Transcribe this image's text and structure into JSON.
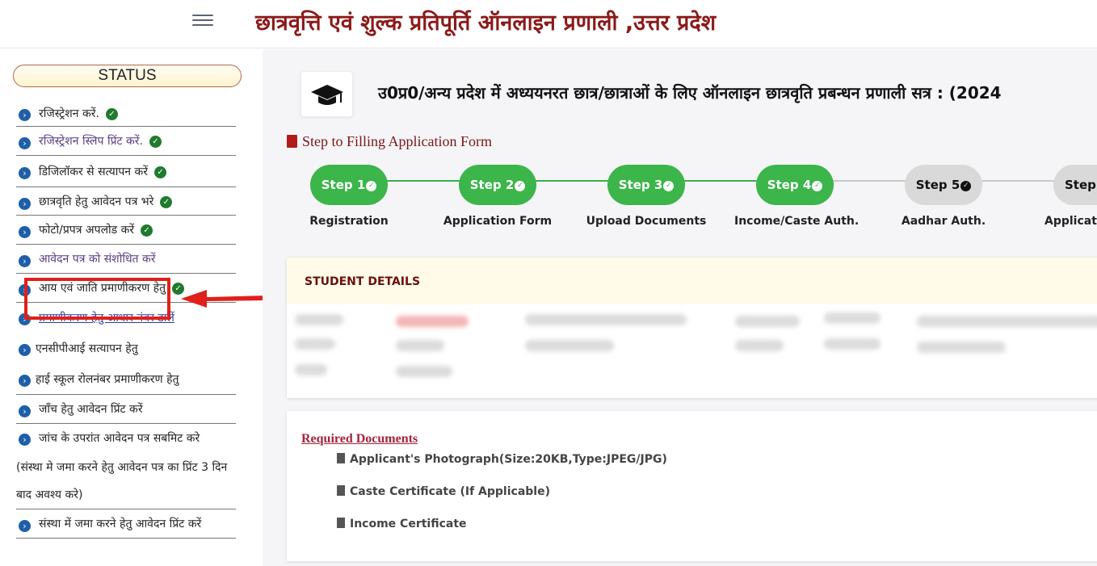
{
  "header": {
    "title": "छात्रवृत्ति एवं शुल्क प्रतिपूर्ति ऑनलाइन प्रणाली ,उत्तर प्रदेश"
  },
  "sidebar": {
    "status_label": "STATUS",
    "items": [
      {
        "label": "रजिस्ट्रेशन करें.",
        "done": true
      },
      {
        "label": "रजिस्ट्रेशन स्लिप प्रिंट करें.",
        "done": true
      },
      {
        "label": "डिजिलॉकर से सत्यापन करें",
        "done": true
      },
      {
        "label": "छात्रवृति हेतु आवेदन पत्र भरे",
        "done": true
      },
      {
        "label": "फोटो/प्रपत्र अपलोड करें",
        "done": true
      },
      {
        "label": "आवेदन पत्र को संशोधित करें",
        "done": false
      },
      {
        "label": "आय एवं जाति प्रमाणीकरण हेतु",
        "done": true
      },
      {
        "label": "प्रमाणीकरण हेतु आधार नंबर डालें",
        "done": false
      },
      {
        "label": "एनसीपीआई सत्यापन हेतु",
        "done": false
      },
      {
        "label": "हाई स्कूल रोलनंबर प्रमाणीकरण हेतु",
        "done": false
      },
      {
        "label": "जाँच हेतु आवेदन प्रिंट करें",
        "done": false
      },
      {
        "label": "जांच के उपरांत आवेदन पत्र सबमिट करे",
        "done": false
      },
      {
        "label": "संस्था में जमा करने हेतु आवेदन प्रिंट करें",
        "done": false
      }
    ],
    "note_line1": "(संस्था मे जमा करने हेतु आवेदन पत्र का प्रिंट 3 दिन",
    "note_line2": "बाद अवश्य करे)"
  },
  "main": {
    "heading": "उ0प्र0/अन्य प्रदेश में अध्ययनरत छात्र/छात्राओं के लिए ऑनलाइन छात्रवृति प्रबन्धन प्रणाली सत्र : (2024",
    "steps_title": "Step to Filling Application Form",
    "steps": [
      {
        "pill": "Step 1",
        "label": "Registration",
        "done": true
      },
      {
        "pill": "Step 2",
        "label": "Application Form",
        "done": true
      },
      {
        "pill": "Step 3",
        "label": "Upload Documents",
        "done": true
      },
      {
        "pill": "Step 4",
        "label": "Income/Caste Auth.",
        "done": true
      },
      {
        "pill": "Step 5",
        "label": "Aadhar Auth.",
        "done": false
      },
      {
        "pill": "Step",
        "label": "Applicati",
        "done": false
      }
    ],
    "student_details_title": "STUDENT DETAILS",
    "required_docs_title": "Required Documents",
    "required_docs": [
      "Applicant's Photograph(Size:20KB,Type:JPEG/JPG)",
      "Caste Certificate (If Applicable)",
      "Income Certificate"
    ]
  },
  "icons": {
    "check": "check-circle-icon",
    "bullet": "chevron-circle-right-icon",
    "cap": "graduation-cap-icon",
    "file": "file-icon"
  },
  "colors": {
    "title": "#8b1a1a",
    "step_done": "#3cb54a",
    "step_todo": "#d9d9d9",
    "highlight": "#e0201a",
    "link": "#a4233b"
  }
}
